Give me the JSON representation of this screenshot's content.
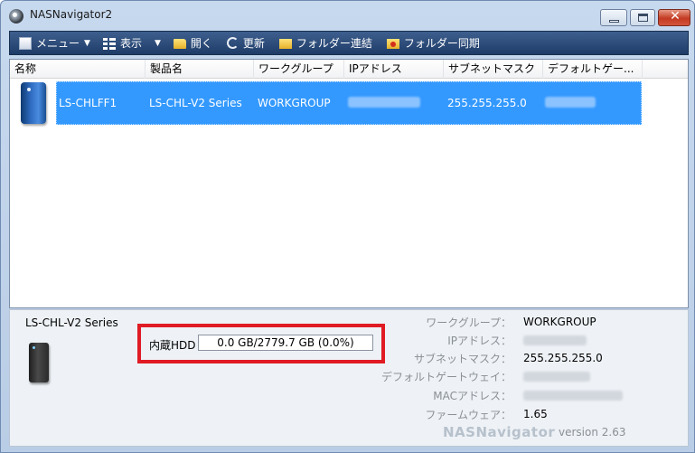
{
  "window": {
    "title": "NASNavigator2"
  },
  "toolbar": {
    "menu_label": "メニュー",
    "view_label": "表示",
    "open_label": "開く",
    "refresh_label": "更新",
    "folder_link_label": "フォルダー連結",
    "folder_sync_label": "フォルダー同期"
  },
  "list": {
    "columns": [
      "名称",
      "製品名",
      "ワークグループ",
      "IPアドレス",
      "サブネットマスク",
      "デフォルトゲー..."
    ],
    "rows": [
      {
        "name": "LS-CHLFF1",
        "product": "LS-CHL-V2 Series",
        "workgroup": "WORKGROUP",
        "ip": "",
        "subnet": "255.255.255.0",
        "gateway": ""
      }
    ]
  },
  "details": {
    "model": "LS-CHL-V2 Series",
    "hdd_label": "内蔵HDD",
    "hdd_usage": "0.0 GB/2779.7 GB (0.0%)",
    "labels": {
      "workgroup": "ワークグループ：",
      "ip": "IPアドレス：",
      "subnet": "サブネットマスク：",
      "gateway": "デフォルトゲートウェイ：",
      "mac": "MACアドレス：",
      "firmware": "ファームウェア："
    },
    "values": {
      "workgroup": "WORKGROUP",
      "subnet": "255.255.255.0",
      "firmware": "1.65"
    },
    "brand": "NASNavigator",
    "version": "version 2.63"
  },
  "colors": {
    "selection": "#3399ff",
    "toolbar": "#2a4a78",
    "highlight_box": "#e01b24"
  },
  "icons": [
    "app-icon",
    "menu-icon",
    "view-icon",
    "folder-open-icon",
    "refresh-icon",
    "folder-link-icon",
    "folder-sync-icon",
    "nas-device-icon"
  ]
}
